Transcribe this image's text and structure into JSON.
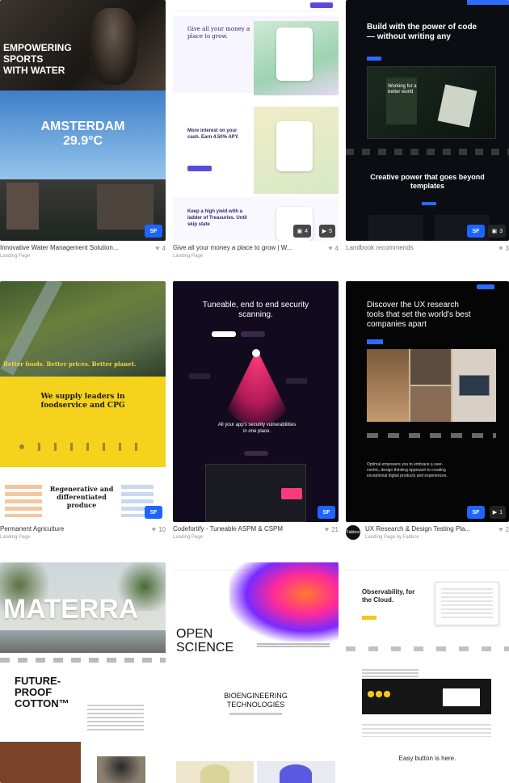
{
  "cards": [
    {
      "title": "Innovative Water Management Solution...",
      "sub": "Landing Page",
      "likes": "4"
    },
    {
      "title": "Give all your money a place to grow | W...",
      "sub": "Landing Page",
      "likes": "4"
    },
    {
      "title": "Landbook recommends",
      "sub": "",
      "likes": "3"
    },
    {
      "title": "Permanent Agriculture",
      "sub": "Landing Page",
      "likes": "10"
    },
    {
      "title": "Codefortify - Tuneable ASPM & CSPM",
      "sub": "Landing Page",
      "likes": "21"
    },
    {
      "title": "UX Research & Design Testing Pla...",
      "sub": "Landing Page by Fabbox",
      "likes": "2"
    }
  ],
  "thumbs": {
    "t1": {
      "headline": "EMPOWERING SPORTS WITH WATER",
      "city": "AMSTERDAM",
      "temp": "29.9°C"
    },
    "t2": {
      "h1": "Give all your money a place to grow.",
      "h2": "More interest on your cash. Earn 4.50% APY.",
      "h3": "Keep a high yield with a ladder of Treasuries. Until skip state",
      "chip1": "4",
      "chip2": "5"
    },
    "t3": {
      "h1": "Build with the power of code — without writing any",
      "inner": "Working for a better world",
      "h2": "Creative power that goes beyond templates",
      "chip": "3"
    },
    "t4": {
      "tagline": "Better foods. Better prices. Better planet.",
      "h1": "We supply leaders in foodservice and CPG",
      "h2": "Regenerative and differentiated produce"
    },
    "t5": {
      "h1": "Tuneable, end to end security scanning.",
      "h2": "All your app's security vulnerabilities in one place."
    },
    "t6": {
      "h1": "Discover the UX research tools that set the world's best companies apart",
      "h2": "Optimal empowers you to embrace a user-centric, design thinking approach to creating exceptional digital products and experiences.",
      "chip": "1"
    },
    "t7": {
      "h1": "MATERRA",
      "h2": "FUTURE-PROOF COTTON™"
    },
    "t8": {
      "h1": "OPEN SCIENCE",
      "h2": "BIOENGINEERING TECHNOLOGIES"
    },
    "t9": {
      "h1": "Observability, for the Cloud.",
      "h2": "Easy button is here."
    }
  },
  "badge": "SF",
  "avatar_label": "Fabbox"
}
